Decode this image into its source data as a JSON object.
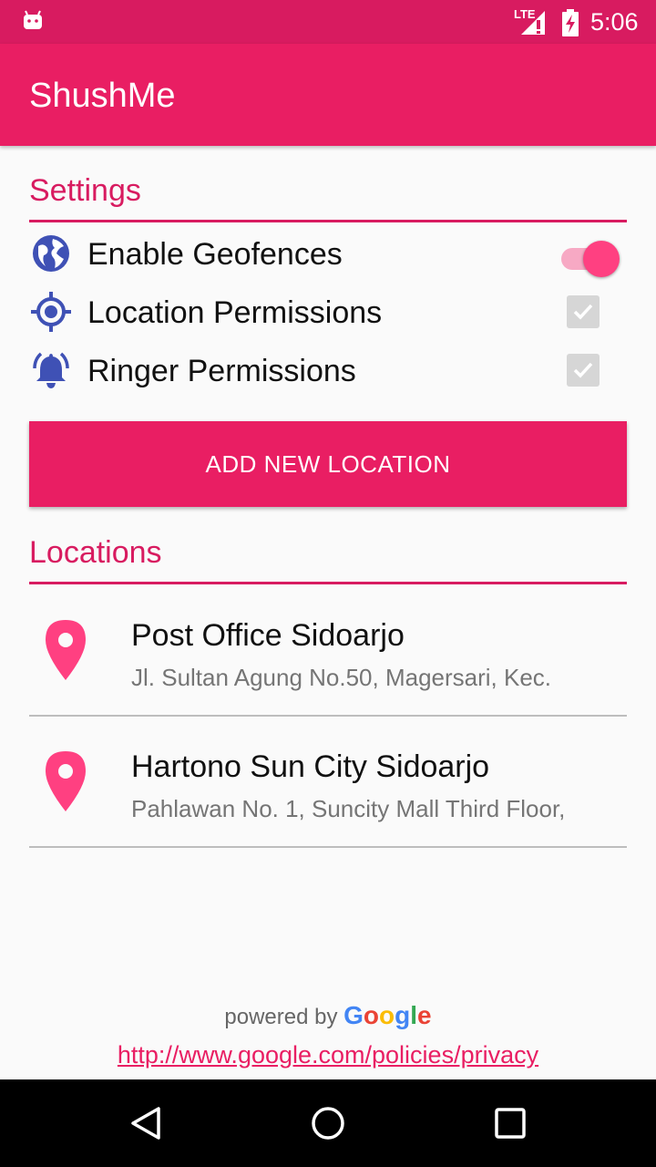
{
  "status_bar": {
    "network": "LTE",
    "time": "5:06"
  },
  "app_bar": {
    "title": "ShushMe"
  },
  "settings": {
    "title": "Settings",
    "items": [
      {
        "label": "Enable Geofences",
        "icon": "globe-icon",
        "control": "switch",
        "checked": true
      },
      {
        "label": "Location Permissions",
        "icon": "gps-location-icon",
        "control": "checkbox",
        "checked": true,
        "enabled": false
      },
      {
        "label": "Ringer Permissions",
        "icon": "bell-ringer-icon",
        "control": "checkbox",
        "checked": true,
        "enabled": false
      }
    ]
  },
  "add_button": {
    "label": "ADD NEW LOCATION"
  },
  "locations": {
    "title": "Locations",
    "items": [
      {
        "name": "Post Office Sidoarjo",
        "address": "Jl. Sultan Agung No.50, Magersari, Kec.",
        "icon": "map-pin-icon"
      },
      {
        "name": "Hartono Sun City Sidoarjo",
        "address": "Pahlawan No. 1, Suncity Mall Third Floor,",
        "icon": "map-pin-icon"
      }
    ]
  },
  "footer": {
    "powered_by": "powered by",
    "google": "Google",
    "privacy_link": "http://www.google.com/policies/privacy"
  },
  "colors": {
    "primary": "#e91e63",
    "primary_dark": "#d81b60",
    "accent": "#ff4081",
    "icon_blue": "#3f51b5"
  }
}
